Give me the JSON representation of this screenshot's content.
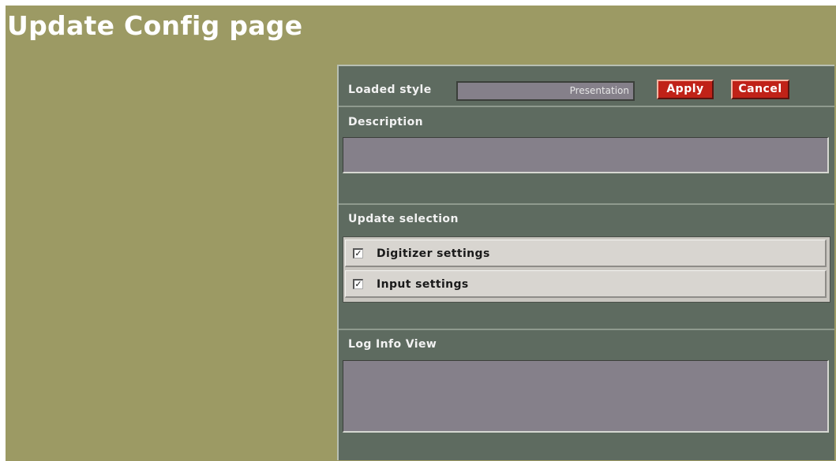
{
  "page": {
    "title": "Update Config page"
  },
  "style_row": {
    "label": "Loaded style",
    "value": "Presentation",
    "apply_label": "Apply",
    "cancel_label": "Cancel"
  },
  "description": {
    "label": "Description",
    "value": ""
  },
  "update_selection": {
    "label": "Update selection",
    "items": [
      {
        "label": "Digitizer settings",
        "checked": true
      },
      {
        "label": "Input settings",
        "checked": true
      }
    ]
  },
  "log": {
    "label": "Log Info View",
    "value": ""
  },
  "colors": {
    "page_bg": "#9c9a64",
    "panel_bg": "#5e6b60",
    "button_red": "#c02218",
    "field_gray": "#85808a"
  }
}
